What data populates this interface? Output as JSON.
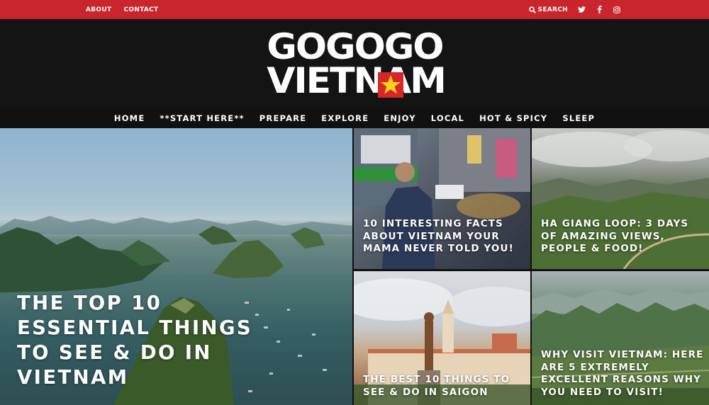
{
  "topbar": {
    "links": [
      "ABOUT",
      "CONTACT"
    ],
    "search_label": "SEARCH",
    "social_icons": [
      "twitter-icon",
      "facebook-icon",
      "instagram-icon"
    ],
    "color": "#c8262c"
  },
  "logo": {
    "line1": "GOGOGO",
    "line2": "VIETNAM"
  },
  "nav": {
    "items": [
      "HOME",
      "**START HERE**",
      "PREPARE",
      "EXPLORE",
      "ENJOY",
      "LOCAL",
      "HOT & SPICY",
      "SLEEP"
    ]
  },
  "posts": [
    {
      "title": "THE TOP 10 ESSENTIAL THINGS TO SEE & DO IN VIETNAM"
    },
    {
      "title": "10 INTERESTING FACTS ABOUT VIETNAM YOUR MAMA NEVER TOLD YOU!"
    },
    {
      "title": "HA GIANG LOOP: 3 DAYS OF AMAZING VIEWS, PEOPLE & FOOD!"
    },
    {
      "title": "THE BEST 10 THINGS TO SEE & DO IN SAIGON"
    },
    {
      "title": "WHY VISIT VIETNAM: HERE ARE 5 EXTREMELY EXCELLENT REASONS WHY YOU NEED TO VISIT!"
    }
  ]
}
